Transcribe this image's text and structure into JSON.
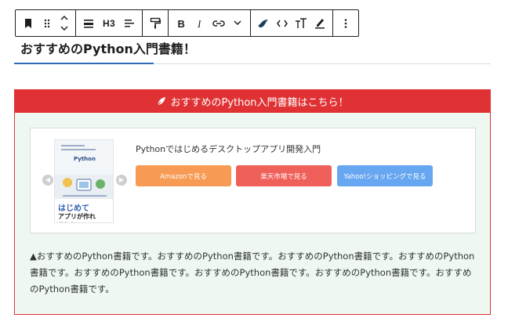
{
  "toolbar": {
    "heading_level": "H3"
  },
  "heading": {
    "text": "おすすめのPython入門書籍！"
  },
  "box": {
    "header": "おすすめのPython入門書籍はこちら！",
    "book_title": "Pythonではじめるデスクトップアプリ開発入門",
    "buttons": {
      "amazon": "Amazonで見る",
      "rakuten": "楽天市場で見る",
      "yahoo": "Yahoo!ショッピングで見る"
    },
    "cover": {
      "title": "Python",
      "big": "はじめて",
      "big2": "アプリが作れる！！"
    },
    "description": "▲おすすめのPython書籍です。おすすめのPython書籍です。おすすめのPython書籍です。おすすめのPython書籍です。おすすめのPython書籍です。おすすめのPython書籍です。おすすめのPython書籍です。おすすめのPython書籍です。"
  },
  "colors": {
    "accent_red": "#e03234",
    "box_bg": "#eef8f0",
    "amazon": "#f79a53",
    "rakuten": "#f0605a",
    "yahoo": "#67a6f0",
    "heading_underline": "#2f6bb3"
  },
  "icons": {
    "bookmark": "bookmark-icon",
    "drag": "drag-handle-icon",
    "move_up": "chevron-up-icon",
    "move_down": "chevron-down-icon",
    "align": "align-icon",
    "text_align": "text-align-icon",
    "format_painter": "paint-roller-icon",
    "bold": "bold-icon",
    "italic": "italic-icon",
    "link": "link-icon",
    "more_rich": "chevron-down-icon",
    "highlight": "ink-drop-icon",
    "code": "code-icon",
    "font_size": "font-size-icon",
    "marker": "marker-pen-icon",
    "more": "more-vertical-icon",
    "feather": "feather-icon"
  }
}
